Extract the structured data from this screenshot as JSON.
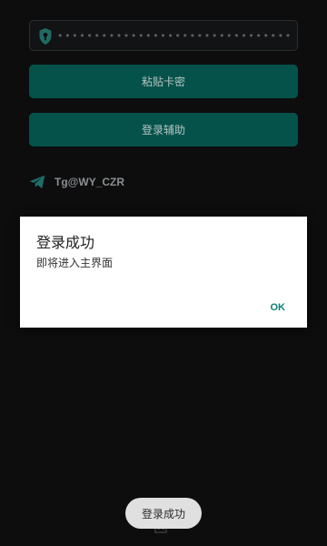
{
  "main": {
    "key_field": {
      "masked_value": "••••••••••••••••••••••••••••••••••••••••••••",
      "icon": "shield-key-icon"
    },
    "paste_button_label": "粘贴卡密",
    "login_assist_button_label": "登录辅助",
    "telegram": {
      "icon": "telegram-icon",
      "label": "Tg@WY_CZR"
    }
  },
  "dialog": {
    "title": "登录成功",
    "message": "即将进入主界面",
    "ok_label": "OK"
  },
  "toast": {
    "text": "登录成功"
  },
  "colors": {
    "background": "#0d0d0e",
    "button": "#05524b",
    "accent": "#0b7f76",
    "dialog_bg": "#ffffff"
  }
}
